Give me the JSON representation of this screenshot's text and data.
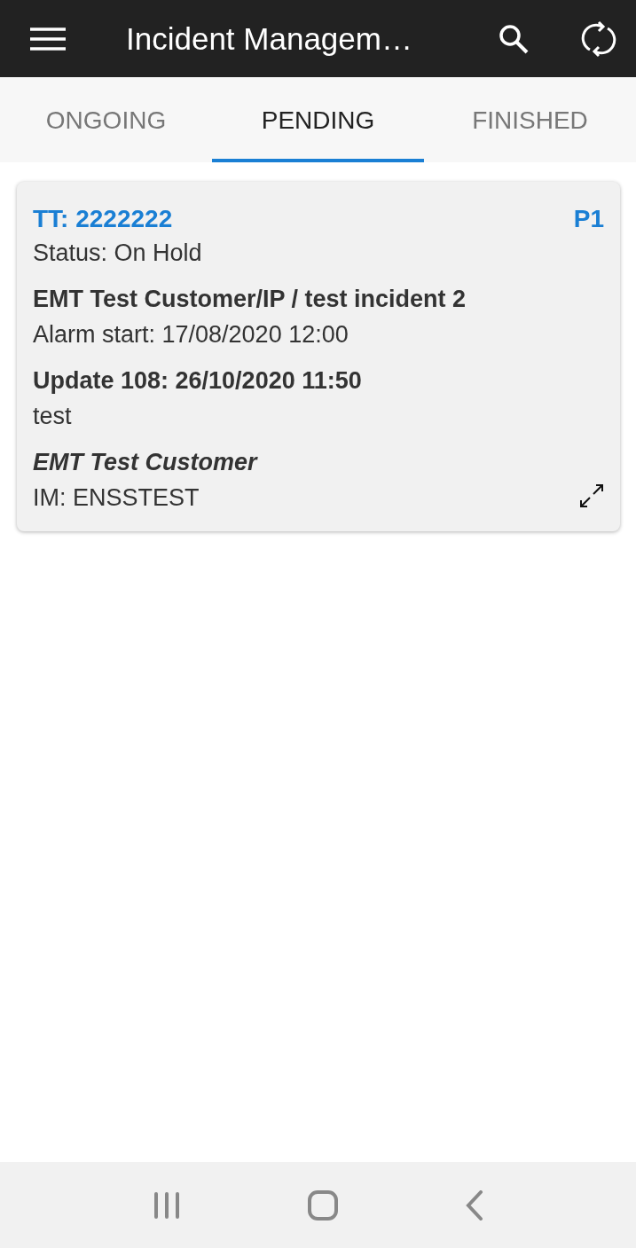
{
  "app_bar": {
    "title": "Incident Managem…"
  },
  "tabs": [
    {
      "label": "ONGOING",
      "selected": false
    },
    {
      "label": "PENDING",
      "selected": true
    },
    {
      "label": "FINISHED",
      "selected": false
    }
  ],
  "incidents": [
    {
      "ticket": "TT: 2222222",
      "priority": "P1",
      "status": "Status: On Hold",
      "title": "EMT Test Customer/IP / test incident 2",
      "alarm_start": "Alarm start: 17/08/2020 12:00",
      "update_heading": "Update 108: 26/10/2020 11:50",
      "update_text": "test",
      "customer": "EMT Test Customer",
      "manager": "IM: ENSSTEST"
    }
  ]
}
